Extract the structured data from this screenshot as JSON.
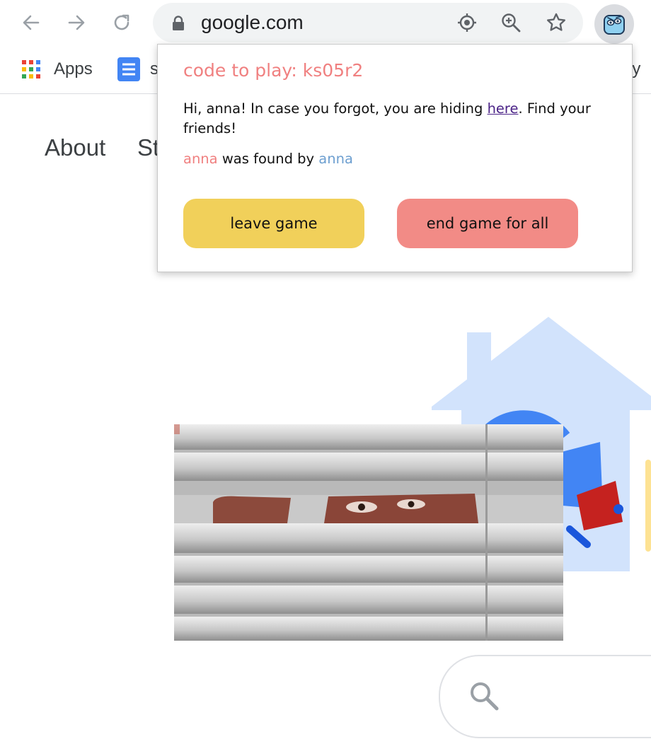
{
  "browser": {
    "url": "google.com",
    "icons": [
      "back-arrow-icon",
      "forward-arrow-icon",
      "reload-icon",
      "lock-icon",
      "location-target-icon",
      "zoom-in-icon",
      "star-icon",
      "extension-face-icon"
    ]
  },
  "bookmarks": {
    "apps_label": "Apps",
    "item2_label": "s",
    "item3_label": "ery"
  },
  "page": {
    "nav_about": "About",
    "nav_store": "St"
  },
  "popup": {
    "code_line": "code to play: ks05r2",
    "msg_before": "Hi, anna! In case you forgot, you are hiding ",
    "msg_link": "here",
    "msg_after": ". Find your friends!",
    "found_name_1": "anna",
    "found_mid": " was found by ",
    "found_name_2": "anna",
    "leave_label": "leave game",
    "end_label": "end game for all"
  },
  "colors": {
    "code_text": "#f08080",
    "leave_button": "#f1d05a",
    "end_button": "#f28b86",
    "found_by_name": "#6d9fd0",
    "link": "#4b2387"
  }
}
